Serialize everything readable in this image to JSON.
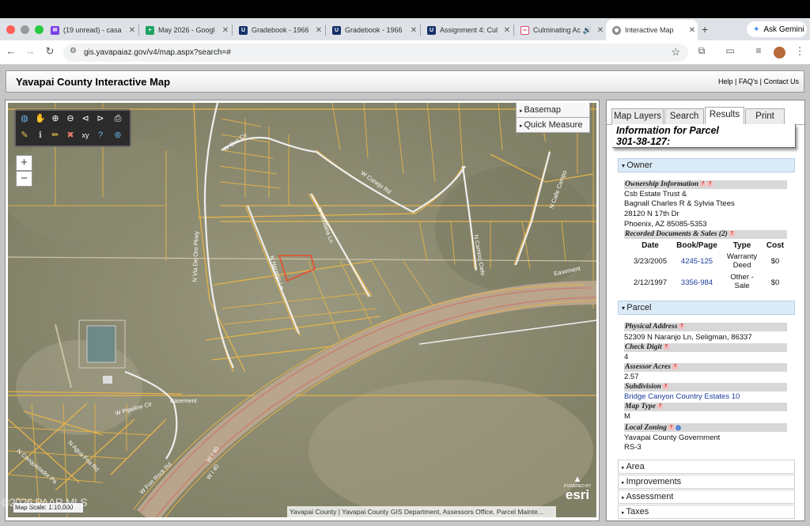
{
  "browser": {
    "tabs": [
      {
        "label": "(19 unread) - casa",
        "icon": "mail-icon",
        "color": "#7b3fe4"
      },
      {
        "label": "May 2026 - Googl",
        "icon": "sheets-icon",
        "color": "#1ea362"
      },
      {
        "label": "Gradebook - 1966",
        "icon": "uc-icon",
        "color": "#14306a"
      },
      {
        "label": "Gradebook - 1966",
        "icon": "uc-icon",
        "color": "#14306a"
      },
      {
        "label": "Assignment 4: Cul",
        "icon": "uc-icon",
        "color": "#14306a"
      },
      {
        "label": "Culminating Ac",
        "icon": "link-icon",
        "color": "#d84a6a"
      },
      {
        "label": "Interactive Map",
        "icon": "globe-icon",
        "color": "#777"
      }
    ],
    "ask_gemini": "Ask Gemini",
    "url": "gis.yavapaiaz.gov/v4/map.aspx?search=#"
  },
  "header": {
    "title": "Yavapai County Interactive Map",
    "links": [
      "Help",
      "FAQ's",
      "Contact Us"
    ]
  },
  "map": {
    "basemap": "Basemap",
    "quick_measure": "Quick Measure",
    "attribution": "Yavapai County | Yavapai County GIS Department, Assessors Office, Parcel Mainte...",
    "scale": "Map Scale: 1:10,000",
    "watermark": "©2026 PAAR MLS",
    "esri_powered": "POWERED BY",
    "esri_logo": "esri",
    "roads": [
      {
        "label": "W Oxo Cir"
      },
      {
        "label": "W Conejo Rd"
      },
      {
        "label": "N Montana Ln"
      },
      {
        "label": "N Calle Campo"
      },
      {
        "label": "N Via De Oro Pkwy"
      },
      {
        "label": "N Naranjo Ln"
      },
      {
        "label": "N Camino Cielo"
      },
      {
        "label": "Easement"
      },
      {
        "label": "Easement"
      },
      {
        "label": "W Pipeline Cir"
      },
      {
        "label": "N Conquistador Pa"
      },
      {
        "label": "N Agua Fria Rd"
      },
      {
        "label": "W Fort Rock Rd"
      },
      {
        "label": "W I 40"
      },
      {
        "label": "W I 40"
      }
    ]
  },
  "panel": {
    "tabs": [
      "Map Layers",
      "Search",
      "Results",
      "Print"
    ],
    "title_line1": "Information for Parcel",
    "title_line2": "301-38-127:",
    "owner_header": "Owner",
    "ownership_label": "Ownership Information",
    "owner_lines": [
      "Csb Estate Trust &",
      "Bagnall Charles R & Sylvia Ttees",
      "28120 N 17th Dr",
      "Phoenix, AZ  85085-5353"
    ],
    "docs_label": "Recorded Documents & Sales (2)",
    "docs_headers": [
      "Date",
      "Book/Page",
      "Type",
      "Cost"
    ],
    "docs": [
      {
        "date": "3/23/2005",
        "book": "4245-125",
        "type": "Warranty Deed",
        "cost": "$0"
      },
      {
        "date": "2/12/1997",
        "book": "3356-984",
        "type": "Other - Sale",
        "cost": "$0"
      }
    ],
    "parcel_header": "Parcel",
    "physical_address_label": "Physical Address",
    "physical_address": "52309 N Naranjo Ln, Seligman, 86337",
    "check_digit_label": "Check Digit",
    "check_digit": "4",
    "acres_label": "Assessor Acres",
    "acres": "2.57",
    "subdivision_label": "Subdivision",
    "subdivision": "Bridge Canyon Country Estates 10",
    "map_type_label": "Map Type",
    "map_type": "M",
    "zoning_label": "Local Zoning",
    "zoning_lines": [
      "Yavapai County Government",
      "RS-3"
    ],
    "collapsed_sections": [
      "Area",
      "Improvements",
      "Assessment",
      "Taxes"
    ]
  }
}
